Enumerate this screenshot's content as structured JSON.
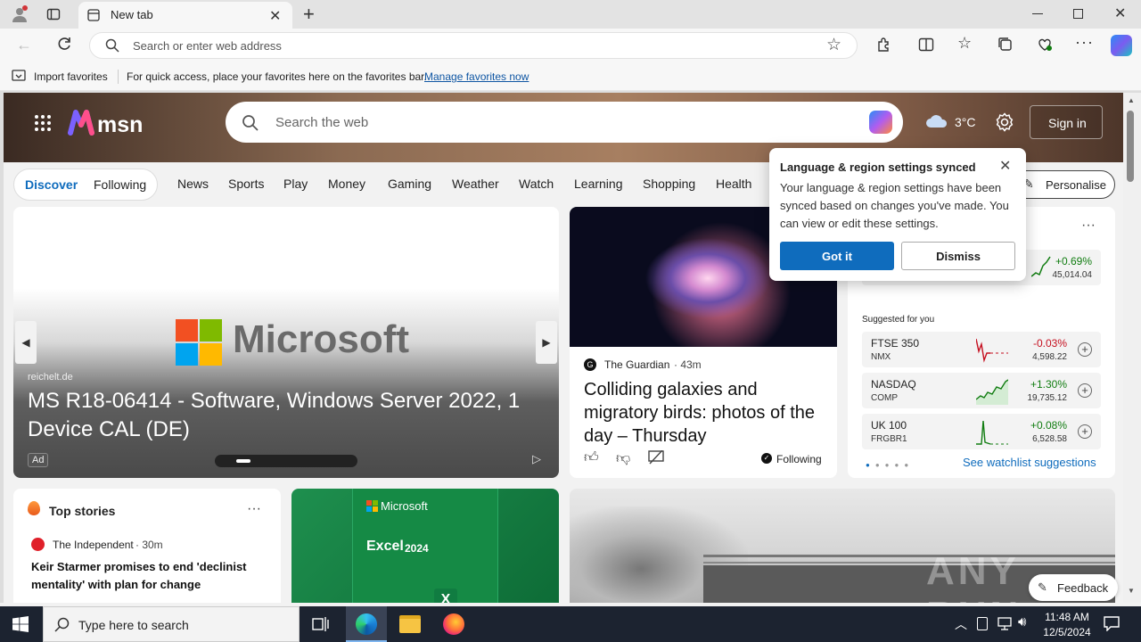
{
  "browser": {
    "tab_title": "New tab",
    "address_placeholder": "Search or enter web address"
  },
  "favorites_bar": {
    "import_label": "Import favorites",
    "hint_text": "For quick access, place your favorites here on the favorites bar.",
    "manage_link": "Manage favorites now"
  },
  "msn": {
    "logo_text": "msn",
    "search_placeholder": "Search the web",
    "weather_temp": "3°C",
    "sign_in": "Sign in"
  },
  "nav": {
    "discover": "Discover",
    "following": "Following",
    "items": [
      "News",
      "Sports",
      "Play",
      "Money",
      "Gaming",
      "Weather",
      "Watch",
      "Learning",
      "Shopping",
      "Health"
    ],
    "personalise": "Personalise"
  },
  "popup": {
    "title": "Language & region settings synced",
    "body": "Your language & region settings have been synced based on changes you've made. You can view or edit these settings.",
    "got_it": "Got it",
    "dismiss": "Dismiss"
  },
  "ad_card": {
    "brand_text": "Microsoft",
    "source": "reichelt.de",
    "headline": "MS R18-06414 - Software, Windows Server 2022, 1 Device CAL (DE)",
    "ad_badge": "Ad"
  },
  "news_card": {
    "source": "The Guardian",
    "time": "· 43m",
    "headline": "Colliding galaxies and migratory birds: photos of the day – Thursday",
    "following": "Following"
  },
  "stocks": {
    "top_row": {
      "pct": "+0.69%",
      "value": "45,014.04",
      "color": "#107c10"
    },
    "suggested_label": "Suggested for you",
    "rows": [
      {
        "name": "FTSE 350",
        "sub": "NMX",
        "pct": "-0.03%",
        "value": "4,598.22",
        "color": "#c50f1f"
      },
      {
        "name": "NASDAQ",
        "sub": "COMP",
        "pct": "+1.30%",
        "value": "19,735.12",
        "color": "#107c10"
      },
      {
        "name": "UK 100",
        "sub": "FRGBR1",
        "pct": "+0.08%",
        "value": "6,528.58",
        "color": "#107c10"
      }
    ],
    "see_link": "See watchlist suggestions"
  },
  "top_stories": {
    "title": "Top stories",
    "source": "The Independent",
    "time": "· 30m",
    "headline": "Keir Starmer promises to end 'declinist mentality' with plan for change"
  },
  "excel_card": {
    "brand": "Microsoft",
    "product": "Excel",
    "year": "2024"
  },
  "feedback": "Feedback",
  "watermark": "ANY RUN",
  "taskbar": {
    "search_placeholder": "Type here to search",
    "time": "11:48 AM",
    "date": "12/5/2024"
  }
}
